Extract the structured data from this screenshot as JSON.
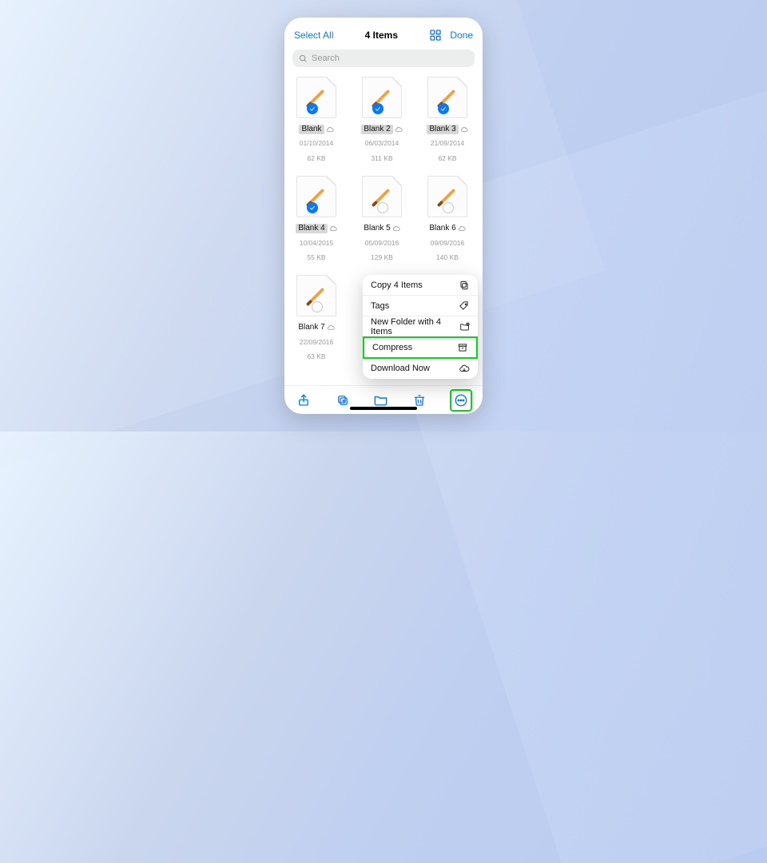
{
  "accent": "#0879ff",
  "topbar": {
    "select_all": "Select All",
    "title": "4 Items",
    "done": "Done"
  },
  "search": {
    "placeholder": "Search"
  },
  "files": [
    {
      "name": "Blank",
      "date": "01/10/2014",
      "size": "62 KB",
      "selected": true
    },
    {
      "name": "Blank 2",
      "date": "06/03/2014",
      "size": "311 KB",
      "selected": true
    },
    {
      "name": "Blank 3",
      "date": "21/09/2014",
      "size": "62 KB",
      "selected": true
    },
    {
      "name": "Blank 4",
      "date": "10/04/2015",
      "size": "55 KB",
      "selected": true
    },
    {
      "name": "Blank 5",
      "date": "05/09/2016",
      "size": "129 KB",
      "selected": false
    },
    {
      "name": "Blank 6",
      "date": "09/09/2016",
      "size": "140 KB",
      "selected": false
    },
    {
      "name": "Blank 7",
      "date": "22/09/2016",
      "size": "63 KB",
      "selected": false
    }
  ],
  "menu": [
    {
      "label": "Copy 4 Items",
      "icon": "copy",
      "highlight": false
    },
    {
      "label": "Tags",
      "icon": "tag",
      "highlight": false
    },
    {
      "label": "New Folder with 4 Items",
      "icon": "folder-plus",
      "highlight": false
    },
    {
      "label": "Compress",
      "icon": "archive",
      "highlight": true
    },
    {
      "label": "Download Now",
      "icon": "cloud-down",
      "highlight": false
    }
  ],
  "toolbar_icons": [
    "share",
    "duplicate",
    "folder",
    "trash",
    "ellipsis"
  ]
}
